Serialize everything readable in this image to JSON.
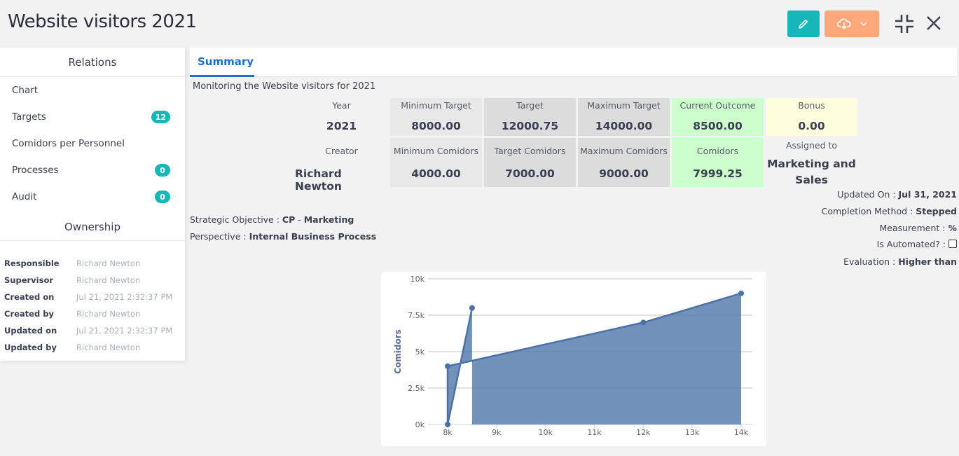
{
  "header": {
    "title": "Website visitors 2021",
    "icons": {
      "edit": "pencil-icon",
      "download": "cloud-download-icon",
      "dropdown": "chevron-down-icon",
      "minimize": "collapse-icon",
      "close": "close-icon"
    },
    "colors": {
      "edit_button": "#17b6b9",
      "download_button": "#fda77b"
    }
  },
  "sidebar": {
    "relations_title": "Relations",
    "relations": [
      {
        "label": "Chart",
        "badge": null
      },
      {
        "label": "Targets",
        "badge": "12"
      },
      {
        "label": "Comidors per Personnel",
        "badge": null
      },
      {
        "label": "Processes",
        "badge": "0"
      },
      {
        "label": "Audit",
        "badge": "0"
      }
    ],
    "ownership_title": "Ownership",
    "ownership": [
      {
        "label": "Responsible",
        "value": "Richard Newton"
      },
      {
        "label": "Supervisor",
        "value": "Richard Newton"
      },
      {
        "label": "Created on",
        "value": "Jul 21, 2021 2:32:37 PM"
      },
      {
        "label": "Created by",
        "value": "Richard Newton"
      },
      {
        "label": "Updated on",
        "value": "Jul 21, 2021 2:32:37 PM"
      },
      {
        "label": "Updated by",
        "value": "Richard Newton"
      }
    ]
  },
  "tabs": [
    {
      "label": "Summary",
      "active": true
    }
  ],
  "summary": {
    "description": "Monitoring the Website visitors for 2021",
    "row1": [
      {
        "label": "Year",
        "value": "2021"
      },
      {
        "label": "Minimum Target",
        "value": "8000.00"
      },
      {
        "label": "Target",
        "value": "12000.75"
      },
      {
        "label": "Maximum Target",
        "value": "14000.00"
      },
      {
        "label": "Current Outcome",
        "value": "8500.00"
      },
      {
        "label": "Bonus",
        "value": "0.00"
      }
    ],
    "row2": [
      {
        "label": "Creator",
        "value": "Richard Newton"
      },
      {
        "label": "Minimum Comidors",
        "value": "4000.00"
      },
      {
        "label": "Target Comidors",
        "value": "7000.00"
      },
      {
        "label": "Maximum Comidors",
        "value": "9000.00"
      },
      {
        "label": "Comidors",
        "value": "7999.25"
      },
      {
        "label": "Assigned to",
        "value": "Marketing and Sales"
      }
    ],
    "colors": {
      "outcome": "#ccffcc",
      "bonus": "#ffffdd"
    }
  },
  "meta": {
    "updated_on_label": "Updated On : ",
    "updated_on": "Jul 31, 2021",
    "completion_label": "Completion Method : ",
    "completion": "Stepped",
    "measurement_label": "Measurement : ",
    "measurement": "%",
    "automated_label": "Is Automated? : ",
    "automated": false,
    "evaluation_label": "Evaluation : ",
    "evaluation": "Higher than",
    "strategic_label": "Strategic Objective : ",
    "strategic_code": "CP",
    "strategic_sep": " - ",
    "strategic_name": "Marketing",
    "perspective_label": "Perspective : ",
    "perspective": "Internal Business Process"
  },
  "chart_data": {
    "type": "area",
    "title": "",
    "xlabel": "",
    "ylabel": "Comidors",
    "xlim": [
      8000,
      14000
    ],
    "ylim": [
      0,
      10000
    ],
    "x_ticks": [
      8000,
      9000,
      10000,
      11000,
      12000,
      13000,
      14000
    ],
    "x_tick_labels": [
      "8k",
      "9k",
      "10k",
      "11k",
      "12k",
      "13k",
      "14k"
    ],
    "y_ticks": [
      0,
      2500,
      5000,
      7500,
      10000
    ],
    "y_tick_labels": [
      "0k",
      "2.5k",
      "5k",
      "7.5k",
      "10k"
    ],
    "grid": true,
    "color": "#4a72a8",
    "series": [
      {
        "name": "Comidors",
        "points": [
          [
            8500,
            7999.25
          ],
          [
            8000,
            0
          ],
          [
            8000,
            4000
          ],
          [
            12000.75,
            7000
          ],
          [
            14000,
            9000
          ]
        ]
      }
    ]
  }
}
